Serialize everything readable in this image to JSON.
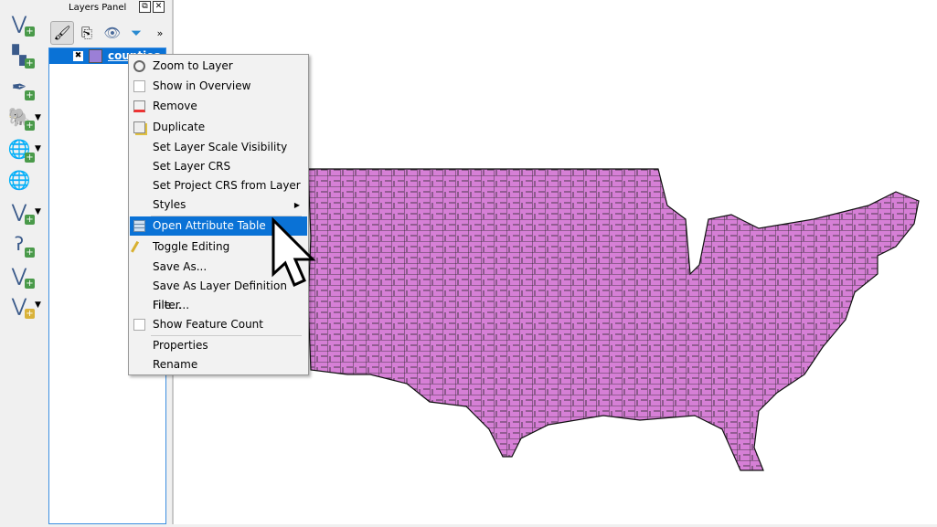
{
  "panel": {
    "title": "Layers Panel",
    "layer_name": "counties",
    "layer_color": "#9b7fd6"
  },
  "toolbar": {
    "icons": [
      "add-vector-layer-icon",
      "add-raster-layer-icon",
      "add-delimited-text-icon",
      "add-postgis-icon",
      "add-wms-icon",
      "add-wfs-icon",
      "add-wcs-icon",
      "add-spatialite-icon",
      "add-virtual-layer-icon",
      "new-shapefile-icon"
    ]
  },
  "menu": {
    "items": [
      {
        "label": "Zoom to Layer",
        "icon": "zoom-icon"
      },
      {
        "label": "Show in Overview",
        "icon": "checkbox"
      },
      {
        "label": "Remove",
        "icon": "remove-icon"
      },
      {
        "label": "Duplicate",
        "icon": "duplicate-icon"
      },
      {
        "label": "Set Layer Scale Visibility"
      },
      {
        "label": "Set Layer CRS"
      },
      {
        "label": "Set Project CRS from Layer"
      },
      {
        "label": "Styles",
        "submenu": true
      },
      {
        "label": "Open Attribute Table",
        "icon": "table-icon",
        "highlighted": true
      },
      {
        "label": "Toggle Editing",
        "icon": "pencil-icon"
      },
      {
        "label": "Save As..."
      },
      {
        "label": "Save As Layer Definition File..."
      },
      {
        "label": "Filter..."
      },
      {
        "label": "Show Feature Count",
        "icon": "checkbox"
      },
      {
        "label": "Properties"
      },
      {
        "label": "Rename"
      }
    ]
  },
  "colors": {
    "map_fill": "#d67fd6",
    "highlight": "#0a72d6"
  }
}
